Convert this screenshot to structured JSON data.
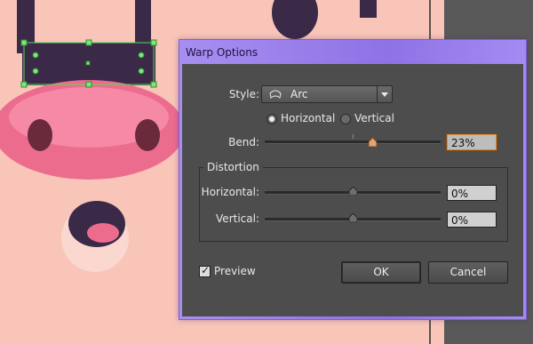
{
  "canvas": {
    "background": "#f8c5b8",
    "side_panel": "#5a5a5a"
  },
  "dialog": {
    "title": "Warp Options",
    "style": {
      "label": "Style:",
      "value": "Arc"
    },
    "orientation": {
      "options": [
        "Horizontal",
        "Vertical"
      ],
      "selected": "Horizontal"
    },
    "bend": {
      "label": "Bend:",
      "value": "23%",
      "level": 0.23
    },
    "distortion": {
      "group_label": "Distortion",
      "horizontal": {
        "label": "Horizontal:",
        "value": "0%",
        "level": 0
      },
      "vertical": {
        "label": "Vertical:",
        "value": "0%",
        "level": 0
      }
    },
    "preview": {
      "label": "Preview",
      "checked": true
    },
    "ok_label": "OK",
    "cancel_label": "Cancel",
    "accent": "#e08a3c"
  }
}
